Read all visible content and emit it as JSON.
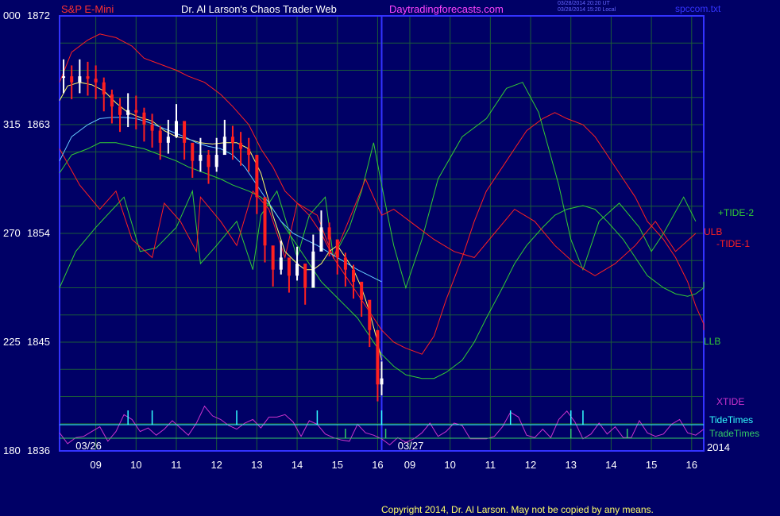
{
  "header": {
    "symbol": "S&P E-Mini",
    "title": "Dr. Al Larson's Chaos Trader Web",
    "site": "Daytradingforecasts.com",
    "stamp_line1": "03/28/2014 20:20 UT",
    "stamp_line2": "03/28/2014 15:20 Local",
    "filename": "spccom.txt",
    "copyright": "Copyright 2014, Dr. Al Larson. May not be copied by any means."
  },
  "colors": {
    "background": "#000066",
    "grid": "#1a5a3a",
    "frame": "#3333ff",
    "price_up": "#ffffff",
    "price_down": "#ff2020",
    "ulb": "#ff2020",
    "llb": "#33cc33",
    "tide1": "#ff2020",
    "tide2": "#33cc33",
    "fast_ma": "#ffff66",
    "slow_ma": "#66ccff",
    "xtide": "#cc33cc",
    "tide_times": "#33ffff",
    "trade_times": "#33cc66",
    "axis_text": "#ffffff",
    "left_labels": "#33cc33"
  },
  "chart_data": {
    "type": "line",
    "y_axis": {
      "ticks": [
        {
          "left": "000",
          "price": "1872",
          "value": 1872
        },
        {
          "left": "315",
          "price": "1863",
          "value": 1863
        },
        {
          "left": "270",
          "price": "1854",
          "value": 1854
        },
        {
          "left": "225",
          "price": "1845",
          "value": 1845
        },
        {
          "left": "180",
          "price": "1836",
          "value": 1836
        }
      ],
      "ylim": [
        1836,
        1872
      ]
    },
    "x_axis": {
      "ticks": [
        "09",
        "10",
        "11",
        "12",
        "13",
        "14",
        "15",
        "16",
        "09",
        "10",
        "11",
        "12",
        "13",
        "14",
        "15",
        "16"
      ],
      "ticks_pos": [
        8.9,
        9.9,
        10.9,
        11.9,
        12.9,
        13.9,
        14.9,
        15.9,
        16.7,
        17.7,
        18.7,
        19.7,
        20.7,
        21.7,
        22.7,
        23.7
      ],
      "xlim": [
        8,
        24
      ],
      "session_break": 16,
      "date_labels": [
        {
          "text": "03/26",
          "at": 8.4
        },
        {
          "text": "03/27",
          "at": 16.4
        }
      ],
      "year_label": "2014"
    },
    "legend": [
      {
        "label": "+TIDE-2",
        "color": "#33cc33"
      },
      {
        "label": "ULB",
        "color": "#ff2020"
      },
      {
        "label": "-TIDE-1",
        "color": "#ff2020"
      },
      {
        "label": "LLB",
        "color": "#33cc33"
      },
      {
        "label": "XTIDE",
        "color": "#cc33cc"
      },
      {
        "label": "TideTimes",
        "color": "#33ffff"
      },
      {
        "label": "TradeTimes",
        "color": "#33cc66"
      }
    ],
    "price_bars": {
      "x": [
        8.1,
        8.3,
        8.5,
        8.7,
        8.9,
        9.1,
        9.3,
        9.5,
        9.7,
        9.9,
        10.1,
        10.3,
        10.5,
        10.7,
        10.9,
        11.1,
        11.3,
        11.5,
        11.7,
        11.9,
        12.1,
        12.3,
        12.5,
        12.7,
        12.9,
        13.1,
        13.3,
        13.5,
        13.7,
        13.9,
        14.1,
        14.3,
        14.5,
        14.7,
        14.9,
        15.1,
        15.3,
        15.5,
        15.7,
        15.9,
        16.0
      ],
      "close": [
        1867.0,
        1866.5,
        1867.0,
        1866.8,
        1866.5,
        1865.5,
        1864.5,
        1863.8,
        1864.2,
        1864.0,
        1863.0,
        1862.5,
        1861.5,
        1862.0,
        1863.3,
        1861.5,
        1860.0,
        1860.5,
        1859.5,
        1860.5,
        1862.0,
        1861.5,
        1861.0,
        1860.5,
        1857.0,
        1853.0,
        1851.0,
        1852.0,
        1850.5,
        1851.5,
        1849.5,
        1852.5,
        1854.5,
        1853.5,
        1852.0,
        1851.0,
        1850.0,
        1848.5,
        1846.0,
        1841.5,
        1842.0
      ],
      "range": 1.4
    },
    "series": [
      {
        "name": "ULB",
        "values": [
          1866.5,
          1869.0,
          1870.0,
          1870.5,
          1870.2,
          1869.5,
          1868.5,
          1868.0,
          1867.5,
          1867.0,
          1866.5,
          1865.5,
          1864.5,
          1863.0,
          1861.0,
          1859.5,
          1857.5,
          1856.5,
          1855.5,
          1854.0,
          1852.0,
          1850.5,
          1849.0,
          1847.5,
          1846.0,
          1845.0,
          1844.5,
          1844.0,
          1845.5,
          1848.5,
          1852.0,
          1855.0,
          1857.5,
          1859.5,
          1861.0,
          1862.5,
          1863.5,
          1864.0,
          1863.5,
          1863.0,
          1862.0,
          1860.5,
          1858.5,
          1857.0,
          1855.0,
          1853.5,
          1852.0,
          1850.0,
          1848.0,
          1846.5,
          1846.0
        ],
        "x": [
          8.0,
          8.3,
          8.7,
          9.0,
          9.4,
          9.8,
          10.1,
          10.5,
          10.9,
          11.2,
          11.6,
          12.0,
          12.3,
          12.7,
          13.0,
          13.3,
          13.6,
          13.9,
          14.2,
          14.5,
          14.8,
          15.1,
          15.4,
          15.7,
          16.0,
          16.3,
          16.6,
          17.0,
          17.3,
          17.6,
          18.0,
          18.3,
          18.6,
          19.0,
          19.3,
          19.6,
          20.0,
          20.3,
          20.6,
          21.0,
          21.3,
          21.6,
          22.0,
          22.3,
          22.6,
          23.0,
          23.3,
          23.6,
          23.8,
          24.0,
          24.0
        ]
      },
      {
        "name": "LLB",
        "values": [
          1859.0,
          1860.5,
          1861.0,
          1861.5,
          1861.5,
          1861.2,
          1861.0,
          1860.5,
          1860.0,
          1859.5,
          1859.0,
          1858.5,
          1858.0,
          1857.5,
          1857.0,
          1856.0,
          1854.5,
          1853.0,
          1851.5,
          1850.0,
          1849.0,
          1848.0,
          1847.0,
          1845.5,
          1844.0,
          1843.0,
          1842.3,
          1842.0,
          1842.0,
          1842.5,
          1843.5,
          1845.0,
          1847.0,
          1849.5,
          1851.5,
          1853.0,
          1854.5,
          1855.5,
          1856.0,
          1856.3,
          1856.0,
          1855.0,
          1853.5,
          1852.0,
          1850.5,
          1849.5,
          1849.0,
          1848.8,
          1849.0,
          1849.5,
          1850.0
        ],
        "x": [
          8.0,
          8.3,
          8.7,
          9.0,
          9.4,
          9.8,
          10.1,
          10.5,
          10.9,
          11.2,
          11.6,
          12.0,
          12.3,
          12.7,
          13.0,
          13.3,
          13.6,
          13.9,
          14.2,
          14.5,
          14.8,
          15.1,
          15.4,
          15.7,
          16.0,
          16.3,
          16.6,
          17.0,
          17.3,
          17.6,
          18.0,
          18.3,
          18.6,
          19.0,
          19.3,
          19.6,
          20.0,
          20.3,
          20.6,
          21.0,
          21.3,
          21.6,
          22.0,
          22.3,
          22.6,
          23.0,
          23.3,
          23.6,
          23.8,
          24.0,
          24.0
        ]
      },
      {
        "name": "+TIDE-2",
        "values": [
          1849.5,
          1852.5,
          1854.5,
          1857.0,
          1852.5,
          1852.8,
          1854.5,
          1857.5,
          1851.5,
          1853.0,
          1855.0,
          1851.0,
          1855.5,
          1857.5,
          1852.0,
          1855.5,
          1857.0,
          1852.0,
          1854.5,
          1857.5,
          1861.5,
          1858.0,
          1853.0,
          1849.5,
          1853.5,
          1858.5,
          1862.0,
          1863.5,
          1866.0,
          1866.5,
          1864.0,
          1858.0,
          1853.5,
          1851.0,
          1855.0,
          1856.5,
          1854.5,
          1852.5,
          1854.0,
          1857.0,
          1855.0
        ],
        "x": [
          8.0,
          8.4,
          8.9,
          9.6,
          10.0,
          10.4,
          10.9,
          11.3,
          11.5,
          11.9,
          12.4,
          12.8,
          13.0,
          13.4,
          13.9,
          14.2,
          14.6,
          14.8,
          15.2,
          15.5,
          15.8,
          16.0,
          16.3,
          16.6,
          17.0,
          17.4,
          18.0,
          18.6,
          19.1,
          19.5,
          19.9,
          20.4,
          20.7,
          21.0,
          21.4,
          21.9,
          22.4,
          22.7,
          23.0,
          23.5,
          23.8
        ]
      },
      {
        "name": "-TIDE-1",
        "values": [
          1861.0,
          1858.0,
          1856.0,
          1857.5,
          1853.5,
          1852.0,
          1856.5,
          1855.0,
          1852.5,
          1857.0,
          1855.0,
          1853.0,
          1857.5,
          1856.0,
          1852.0,
          1856.5,
          1855.5,
          1852.0,
          1856.0,
          1858.5,
          1855.5,
          1856.0,
          1855.0,
          1853.5,
          1852.5,
          1852.0,
          1854.0,
          1856.0,
          1855.0,
          1853.0,
          1851.5,
          1850.5,
          1851.5,
          1853.0,
          1855.0,
          1852.5,
          1854.0
        ],
        "x": [
          8.0,
          8.5,
          9.0,
          9.4,
          9.8,
          10.3,
          10.6,
          11.0,
          11.4,
          11.5,
          12.0,
          12.4,
          12.8,
          13.2,
          13.6,
          13.9,
          14.4,
          14.8,
          15.3,
          15.6,
          16.0,
          16.3,
          16.7,
          17.3,
          17.8,
          18.3,
          18.8,
          19.3,
          19.8,
          20.3,
          20.8,
          21.3,
          21.8,
          22.3,
          22.8,
          23.3,
          23.8
        ]
      },
      {
        "name": "FastMA",
        "values": [
          1865.0,
          1866.2,
          1866.5,
          1866.3,
          1865.8,
          1864.8,
          1864.0,
          1863.6,
          1863.3,
          1862.5,
          1862.0,
          1861.8,
          1861.5,
          1861.4,
          1861.5,
          1861.5,
          1861.0,
          1859.0,
          1855.5,
          1852.5,
          1851.5,
          1851.0,
          1851.0,
          1851.5,
          1852.5,
          1853.0,
          1852.0,
          1851.0,
          1849.5,
          1847.5,
          1845.0,
          1843.5
        ],
        "x": [
          8.0,
          8.2,
          8.5,
          8.8,
          9.1,
          9.4,
          9.7,
          10.0,
          10.3,
          10.6,
          10.9,
          11.2,
          11.5,
          11.8,
          12.1,
          12.4,
          12.7,
          13.0,
          13.3,
          13.6,
          13.9,
          14.1,
          14.3,
          14.5,
          14.7,
          14.9,
          15.1,
          15.3,
          15.5,
          15.7,
          15.9,
          16.0
        ]
      },
      {
        "name": "SlowMA",
        "values": [
          1860.0,
          1862.0,
          1863.0,
          1863.5,
          1863.6,
          1863.6,
          1863.5,
          1863.2,
          1862.8,
          1862.4,
          1862.0,
          1861.5,
          1861.2,
          1861.0,
          1860.5,
          1859.5,
          1858.0,
          1856.5,
          1855.0,
          1854.0,
          1853.0,
          1852.0,
          1851.0,
          1850.0
        ],
        "x": [
          8.0,
          8.3,
          8.7,
          9.0,
          9.3,
          9.6,
          9.9,
          10.2,
          10.5,
          10.8,
          11.1,
          11.4,
          11.7,
          12.0,
          12.3,
          12.6,
          12.9,
          13.2,
          13.5,
          13.8,
          14.4,
          14.9,
          15.4,
          16.0
        ]
      }
    ],
    "xtide": {
      "x": [
        8.0,
        8.2,
        8.4,
        8.6,
        8.8,
        9.0,
        9.2,
        9.4,
        9.6,
        9.8,
        10.0,
        10.2,
        10.4,
        10.6,
        10.8,
        11.0,
        11.2,
        11.4,
        11.6,
        11.8,
        12.0,
        12.2,
        12.4,
        12.6,
        12.8,
        13.0,
        13.2,
        13.4,
        13.6,
        13.8,
        14.0,
        14.2,
        14.4,
        14.6,
        14.8,
        15.0,
        15.2,
        15.4,
        15.6,
        15.8,
        16.0,
        16.2,
        16.4,
        16.6,
        16.8,
        17.0,
        17.2,
        17.4,
        17.6,
        17.8,
        18.0,
        18.2,
        18.4,
        18.6,
        18.8,
        19.0,
        19.2,
        19.4,
        19.6,
        19.8,
        20.0,
        20.2,
        20.4,
        20.6,
        20.8,
        21.0,
        21.2,
        21.4,
        21.6,
        21.8,
        22.0,
        22.2,
        22.4,
        22.6,
        22.8,
        23.0,
        23.2,
        23.4,
        23.6,
        23.8,
        24.0
      ],
      "values": [
        1837.5,
        1836.6,
        1837.1,
        1837.2,
        1837.6,
        1838.0,
        1836.8,
        1837.6,
        1839.0,
        1838.6,
        1837.6,
        1837.9,
        1837.3,
        1837.8,
        1838.5,
        1837.9,
        1837.3,
        1838.3,
        1839.7,
        1838.9,
        1838.6,
        1838.1,
        1837.8,
        1838.3,
        1838.6,
        1837.9,
        1838.8,
        1838.8,
        1839.0,
        1838.4,
        1837.2,
        1838.5,
        1838.2,
        1837.4,
        1837.1,
        1836.9,
        1836.8,
        1838.2,
        1837.5,
        1837.3,
        1837.0,
        1836.5,
        1837.1,
        1836.7,
        1837.0,
        1837.5,
        1838.3,
        1837.2,
        1837.6,
        1838.3,
        1838.1,
        1837.0,
        1837.0,
        1837.0,
        1837.2,
        1838.0,
        1839.2,
        1838.8,
        1837.3,
        1837.1,
        1837.8,
        1837.1,
        1838.6,
        1839.3,
        1838.4,
        1837.0,
        1837.4,
        1838.3,
        1837.4,
        1838.0,
        1837.1,
        1837.1,
        1838.5,
        1837.5,
        1837.2,
        1837.4,
        1838.2,
        1838.6,
        1837.5,
        1837.3,
        1837.8
      ]
    },
    "tide_times": [
      9.7,
      10.3,
      12.4,
      14.4,
      16.0,
      19.2,
      20.7,
      21.0
    ],
    "trade_times": [
      15.1,
      16.1,
      20.7,
      22.1
    ]
  }
}
